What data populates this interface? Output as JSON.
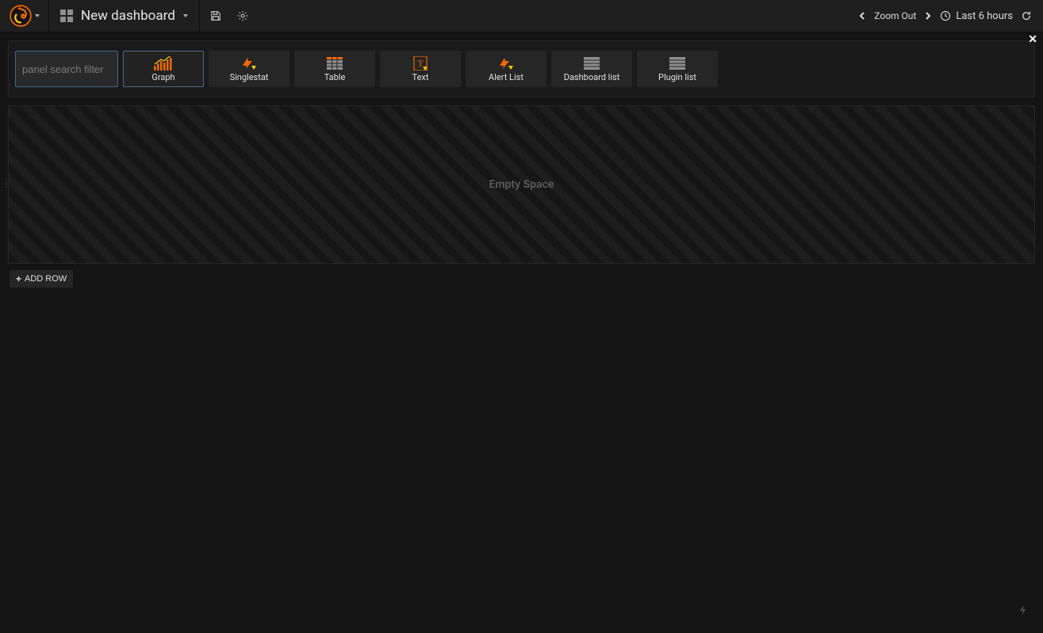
{
  "navbar": {
    "title": "New dashboard",
    "zoom_out_label": "Zoom Out",
    "time_range_label": "Last 6 hours"
  },
  "panel_picker": {
    "search_placeholder": "panel search filter",
    "tiles": [
      {
        "label": "Graph"
      },
      {
        "label": "Singlestat"
      },
      {
        "label": "Table"
      },
      {
        "label": "Text"
      },
      {
        "label": "Alert List"
      },
      {
        "label": "Dashboard list"
      },
      {
        "label": "Plugin list"
      }
    ]
  },
  "dashboard": {
    "empty_space_label": "Empty Space",
    "add_row_label": "ADD ROW"
  }
}
